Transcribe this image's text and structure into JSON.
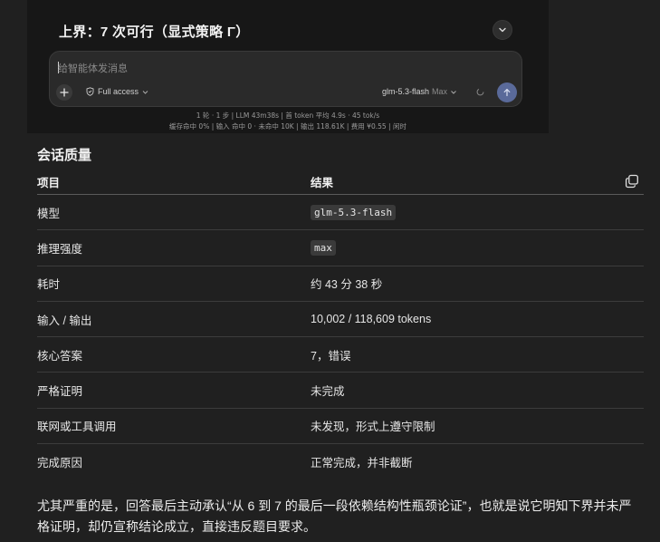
{
  "chat": {
    "heading": "上界：7 次可行（显式策略 Γ）",
    "input_placeholder": "给智能体发消息",
    "access_label": "Full access",
    "model_name": "glm-5.3-flash",
    "model_effort": "Max",
    "stats_line1": "1 轮 · 1 步  |  LLM 43m38s  |  首 token 平均 4.9s · 45 tok/s",
    "stats_line2": "缓存命中 0%  |  输入 命中 0 · 未命中 10K  |  输出 118.61K  |  费用 ¥0.55  |  闲时"
  },
  "section": {
    "title": "会话质量"
  },
  "table": {
    "headers": [
      "项目",
      "结果"
    ],
    "rows": [
      {
        "item": "模型",
        "result": "glm-5.3-flash",
        "code": true
      },
      {
        "item": "推理强度",
        "result": "max",
        "code": true
      },
      {
        "item": "耗时",
        "result": "约 43 分 38 秒",
        "code": false
      },
      {
        "item": "输入 / 输出",
        "result": "10,002 / 118,609 tokens",
        "code": false
      },
      {
        "item": "核心答案",
        "result": "7，错误",
        "code": false
      },
      {
        "item": "严格证明",
        "result": "未完成",
        "code": false
      },
      {
        "item": "联网或工具调用",
        "result": "未发现，形式上遵守限制",
        "code": false
      },
      {
        "item": "完成原因",
        "result": "正常完成，并非截断",
        "code": false
      }
    ]
  },
  "paragraph": "尤其严重的是，回答最后主动承认“从 6 到 7 的最后一段依赖结构性瓶颈论证”，也就是说它明知下界并未严格证明，却仍宣称结论成立，直接违反题目要求。",
  "icons": {
    "scroll": "chevron-down-icon",
    "plus": "plus-icon",
    "shield": "shield-icon",
    "send": "arrow-up-icon",
    "copy": "copy-icon"
  },
  "colors": {
    "background": "#202020",
    "panel": "#171717",
    "send_button": "#5a6a9a"
  }
}
